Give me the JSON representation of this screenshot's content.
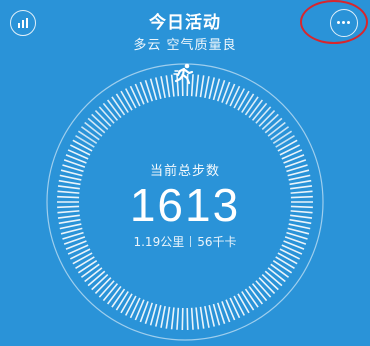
{
  "header": {
    "title": "今日活动",
    "subtitle": "多云 空气质量良"
  },
  "icons": {
    "stats": "bar-chart-icon",
    "more": "more-dots-icon",
    "activity": "running-person-icon"
  },
  "summary": {
    "label": "当前总步数",
    "steps": "1613",
    "distance": "1.19公里",
    "calories": "56千卡"
  },
  "colors": {
    "background": "#2a93d8",
    "highlight_circle": "#d8262d",
    "text": "#ffffff"
  }
}
